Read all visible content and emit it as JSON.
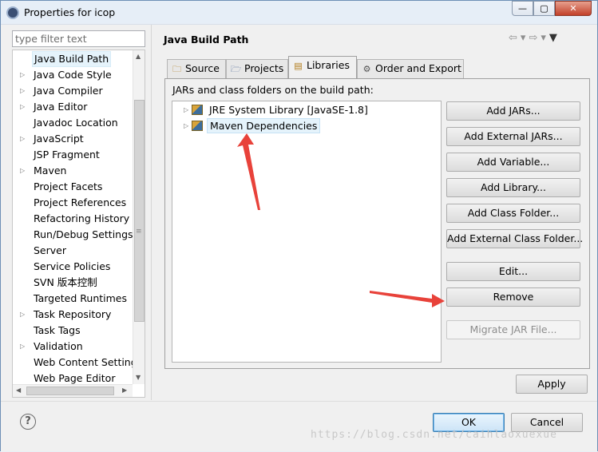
{
  "window": {
    "title": "Properties for icop",
    "min_label": "—",
    "max_label": "▢",
    "close_label": "✕"
  },
  "filter": {
    "placeholder": "type filter text"
  },
  "sidebar": {
    "items": [
      {
        "label": "Java Build Path",
        "expandable": false,
        "selected": true
      },
      {
        "label": "Java Code Style",
        "expandable": true
      },
      {
        "label": "Java Compiler",
        "expandable": true
      },
      {
        "label": "Java Editor",
        "expandable": true
      },
      {
        "label": "Javadoc Location",
        "expandable": false
      },
      {
        "label": "JavaScript",
        "expandable": true
      },
      {
        "label": "JSP Fragment",
        "expandable": false
      },
      {
        "label": "Maven",
        "expandable": true
      },
      {
        "label": "Project Facets",
        "expandable": false
      },
      {
        "label": "Project References",
        "expandable": false
      },
      {
        "label": "Refactoring History",
        "expandable": false
      },
      {
        "label": "Run/Debug Settings",
        "expandable": false
      },
      {
        "label": "Server",
        "expandable": false
      },
      {
        "label": "Service Policies",
        "expandable": false
      },
      {
        "label": "SVN 版本控制",
        "expandable": false
      },
      {
        "label": "Targeted Runtimes",
        "expandable": false
      },
      {
        "label": "Task Repository",
        "expandable": true
      },
      {
        "label": "Task Tags",
        "expandable": false
      },
      {
        "label": "Validation",
        "expandable": true
      },
      {
        "label": "Web Content Settings",
        "expandable": false
      },
      {
        "label": "Web Page Editor",
        "expandable": false
      }
    ]
  },
  "page": {
    "title": "Java Build Path",
    "tabs": [
      {
        "label": "Source",
        "icon": "source-folder-icon"
      },
      {
        "label": "Projects",
        "icon": "projects-icon"
      },
      {
        "label": "Libraries",
        "icon": "libraries-icon",
        "active": true
      },
      {
        "label": "Order and Export",
        "icon": "order-export-icon"
      }
    ],
    "hint": "JARs and class folders on the build path:",
    "libraries": [
      {
        "label": "JRE System Library [JavaSE-1.8]",
        "selected": false
      },
      {
        "label": "Maven Dependencies",
        "selected": true
      }
    ],
    "buttons": {
      "add_jars": "Add JARs...",
      "add_external_jars": "Add External JARs...",
      "add_variable": "Add Variable...",
      "add_library": "Add Library...",
      "add_class_folder": "Add Class Folder...",
      "add_external_class_folder": "Add External Class Folder...",
      "edit": "Edit...",
      "remove": "Remove",
      "migrate_jar": "Migrate JAR File..."
    },
    "apply": "Apply"
  },
  "footer": {
    "help": "?",
    "ok": "OK",
    "cancel": "Cancel"
  },
  "watermark": "https://blog.csdn.net/caihlaoxuexue",
  "colors": {
    "annotation_arrow": "#e8423a",
    "selection": "#e5f3fb",
    "ok_border": "#3c7fb1"
  }
}
